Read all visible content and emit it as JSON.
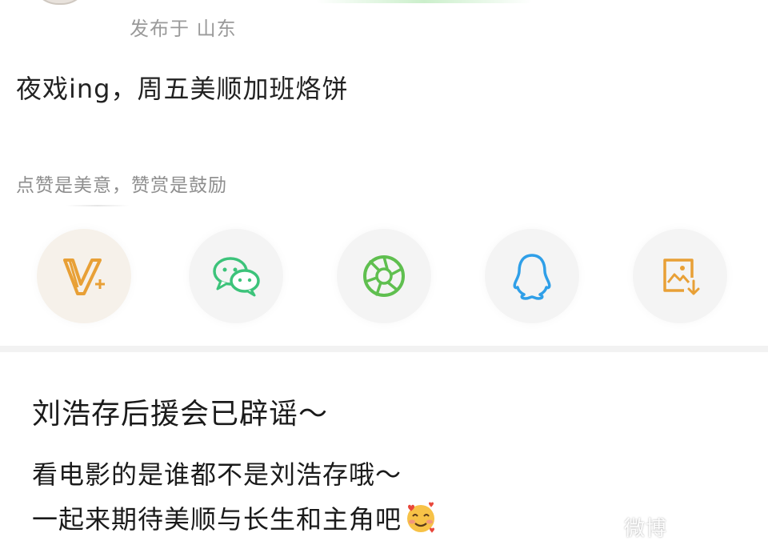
{
  "post": {
    "location": "发布于 山东",
    "text": "夜戏ing，周五美顺加班烙饼",
    "tip": "点赞是美意，赞赏是鼓励"
  },
  "share": {
    "buttons": [
      {
        "name": "vplus",
        "icon": "v-plus-icon",
        "color": "#e8a036"
      },
      {
        "name": "wechat",
        "icon": "wechat-icon",
        "color": "#3cc37a"
      },
      {
        "name": "moments",
        "icon": "moments-aperture-icon",
        "color": "#5fbf4f"
      },
      {
        "name": "qq",
        "icon": "qq-penguin-icon",
        "color": "#2f9fe8"
      },
      {
        "name": "save-image",
        "icon": "save-image-icon",
        "color": "#e8a036"
      }
    ]
  },
  "caption": {
    "headline": "刘浩存后援会已辟谣～",
    "line1": "看电影的是谁都不是刘浩存哦～",
    "line2": "一起来期待美顺与长生和主角吧",
    "emoji": "smiling-face-with-hearts-icon"
  },
  "watermark": "微博"
}
